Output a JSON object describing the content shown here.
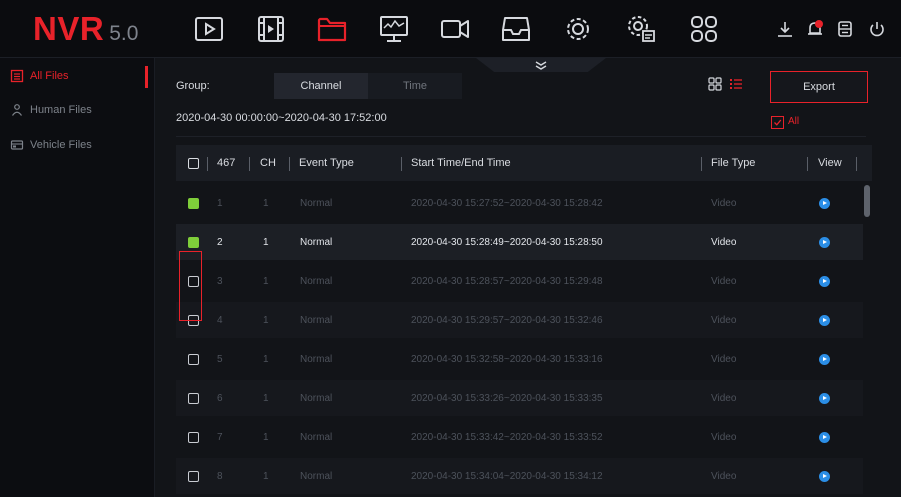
{
  "logo": {
    "brand": "NVR",
    "version": "5.0"
  },
  "nav": {
    "icons": [
      "play-icon",
      "film-icon",
      "folder-icon",
      "monitor-icon",
      "camera-icon",
      "disk-icon",
      "gear-icon",
      "settings-calendar-icon",
      "apps-grid-icon"
    ],
    "active_icon": "folder-icon",
    "right_icons": [
      "download-icon",
      "notification-icon",
      "storage-icon",
      "power-icon"
    ]
  },
  "sidebar": {
    "items": [
      {
        "label": "All Files",
        "icon": "file-list-icon",
        "active": true
      },
      {
        "label": "Human Files",
        "icon": "human-icon",
        "active": false
      },
      {
        "label": "Vehicle Files",
        "icon": "vehicle-icon",
        "active": false
      }
    ]
  },
  "header": {
    "group_label": "Group:",
    "tab_channel": "Channel",
    "tab_time": "Time",
    "date_range": "2020-04-30 00:00:00~2020-04-30 17:52:00",
    "export_label": "Export",
    "all_label": "All",
    "all_checked": true
  },
  "table": {
    "columns": {
      "count": "467",
      "ch": "CH",
      "event": "Event Type",
      "time": "Start Time/End Time",
      "filetype": "File Type",
      "view": "View"
    },
    "rows": [
      {
        "no": "1",
        "ch": "1",
        "event": "Normal",
        "time": "2020-04-30 15:27:52~2020-04-30 15:28:42",
        "filetype": "Video",
        "checked": true
      },
      {
        "no": "2",
        "ch": "1",
        "event": "Normal",
        "time": "2020-04-30 15:28:49~2020-04-30 15:28:50",
        "filetype": "Video",
        "checked": true
      },
      {
        "no": "3",
        "ch": "1",
        "event": "Normal",
        "time": "2020-04-30 15:28:57~2020-04-30 15:29:48",
        "filetype": "Video",
        "checked": false
      },
      {
        "no": "4",
        "ch": "1",
        "event": "Normal",
        "time": "2020-04-30 15:29:57~2020-04-30 15:32:46",
        "filetype": "Video",
        "checked": false
      },
      {
        "no": "5",
        "ch": "1",
        "event": "Normal",
        "time": "2020-04-30 15:32:58~2020-04-30 15:33:16",
        "filetype": "Video",
        "checked": false
      },
      {
        "no": "6",
        "ch": "1",
        "event": "Normal",
        "time": "2020-04-30 15:33:26~2020-04-30 15:33:35",
        "filetype": "Video",
        "checked": false
      },
      {
        "no": "7",
        "ch": "1",
        "event": "Normal",
        "time": "2020-04-30 15:33:42~2020-04-30 15:33:52",
        "filetype": "Video",
        "checked": false
      },
      {
        "no": "8",
        "ch": "1",
        "event": "Normal",
        "time": "2020-04-30 15:34:04~2020-04-30 15:34:12",
        "filetype": "Video",
        "checked": false
      }
    ],
    "highlighted_row": 2
  },
  "colors": {
    "accent": "#e8222a",
    "checked": "#7fce3a",
    "play": "#2b8ee6",
    "background": "#121418"
  }
}
